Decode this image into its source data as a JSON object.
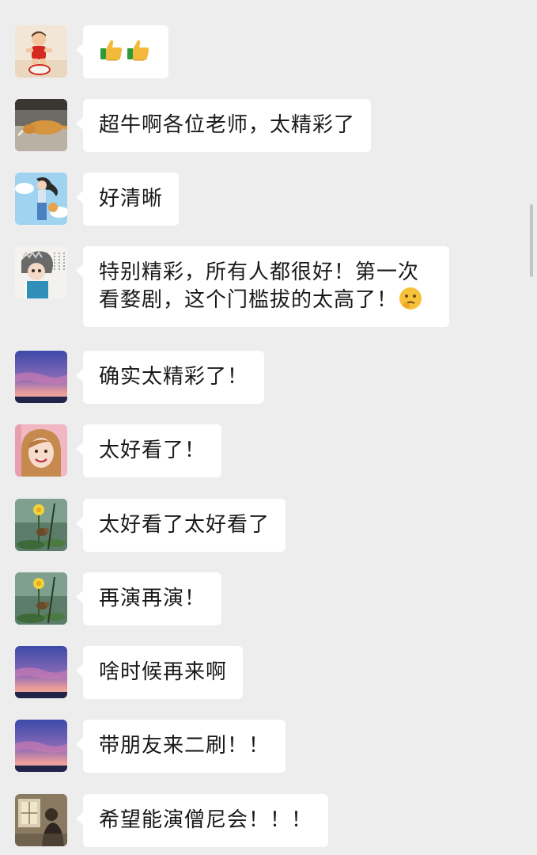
{
  "messages": [
    {
      "avatar": "avatar-toddler-red-shirt",
      "text": "",
      "emoji": [
        "thumbs-up-icon",
        "thumbs-up-icon"
      ]
    },
    {
      "avatar": "avatar-sleeping-dog",
      "text": "超牛啊各位老师，太精彩了"
    },
    {
      "avatar": "avatar-illustrated-girl",
      "text": "好清晰"
    },
    {
      "avatar": "avatar-cartoon-girl",
      "text": "特别精彩，所有人都很好！第一次看婺剧，这个门槛拔的太高了！",
      "trailing_emoji": "thinking-face-icon"
    },
    {
      "avatar": "avatar-purple-sunset",
      "text": "确实太精彩了！"
    },
    {
      "avatar": "avatar-smiling-woman",
      "text": "太好看了！"
    },
    {
      "avatar": "avatar-lotus-bird",
      "text": "太好看了太好看了"
    },
    {
      "avatar": "avatar-lotus-bird",
      "text": "再演再演！"
    },
    {
      "avatar": "avatar-purple-sunset",
      "text": "啥时候再来啊"
    },
    {
      "avatar": "avatar-purple-sunset",
      "text": "带朋友来二刷！！"
    },
    {
      "avatar": "avatar-window-portrait",
      "text": "希望能演僧尼会！！！"
    }
  ],
  "colors": {
    "background": "#ededed",
    "bubble": "#ffffff",
    "text": "#191919"
  }
}
